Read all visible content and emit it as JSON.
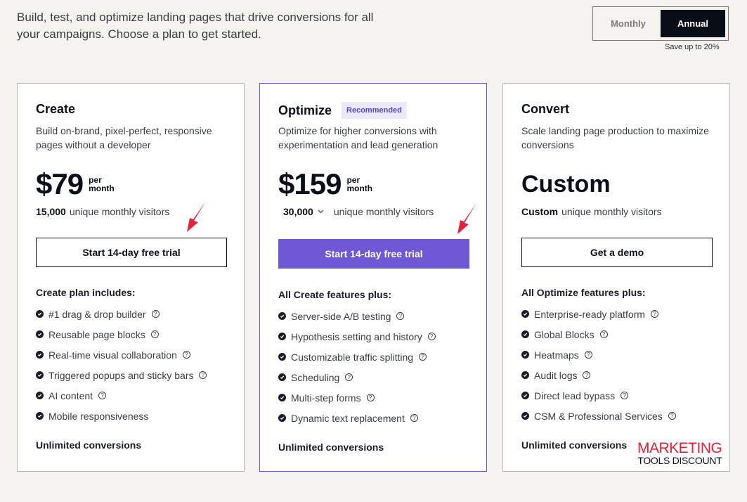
{
  "intro": {
    "text": "Build, test, and optimize landing pages that drive conversions for all your campaigns. Choose a plan to get started."
  },
  "billing": {
    "options": [
      "Monthly",
      "Annual"
    ],
    "selected": "Annual",
    "save_note": "Save up to 20%"
  },
  "colors": {
    "accent": "#6e58d4",
    "dark": "#0b0f1a",
    "background": "#f4f3ef",
    "annotation_arrow": "#e4213a"
  },
  "plans": [
    {
      "name": "Create",
      "badge": null,
      "description": "Build on-brand, pixel-perfect, responsive pages without a developer",
      "price": "$79",
      "price_unit_1": "per",
      "price_unit_2": "month",
      "visitors_value": "15,000",
      "visitors_label": "unique monthly visitors",
      "visitors_selectable": false,
      "cta": "Start 14-day free trial",
      "features_title": "Create plan includes:",
      "features": [
        {
          "label": "#1 drag & drop builder",
          "help": true
        },
        {
          "label": "Reusable page blocks",
          "help": true
        },
        {
          "label": "Real-time visual collaboration",
          "help": true
        },
        {
          "label": "Triggered popups and sticky bars",
          "help": true
        },
        {
          "label": "AI content",
          "help": true
        },
        {
          "label": "Mobile responsiveness",
          "help": false
        }
      ],
      "footer": "Unlimited conversions"
    },
    {
      "name": "Optimize",
      "badge": "Recommended",
      "description": "Optimize for higher conversions with experimentation and lead generation",
      "price": "$159",
      "price_unit_1": "per",
      "price_unit_2": "month",
      "visitors_value": "30,000",
      "visitors_label": "unique monthly visitors",
      "visitors_selectable": true,
      "cta": "Start 14-day free trial",
      "features_title": "All Create features plus:",
      "features": [
        {
          "label": "Server-side A/B testing",
          "help": true
        },
        {
          "label": "Hypothesis setting and history",
          "help": true
        },
        {
          "label": "Customizable traffic splitting",
          "help": true
        },
        {
          "label": "Scheduling",
          "help": true
        },
        {
          "label": "Multi-step forms",
          "help": true
        },
        {
          "label": "Dynamic text replacement",
          "help": true
        }
      ],
      "footer": "Unlimited conversions"
    },
    {
      "name": "Convert",
      "badge": null,
      "description": "Scale landing page production to maximize conversions",
      "price": "Custom",
      "visitors_value": "Custom",
      "visitors_label": "unique monthly visitors",
      "visitors_selectable": false,
      "cta": "Get a demo",
      "features_title": "All Optimize features plus:",
      "features": [
        {
          "label": "Enterprise-ready platform",
          "help": true
        },
        {
          "label": "Global Blocks",
          "help": true
        },
        {
          "label": "Heatmaps",
          "help": true
        },
        {
          "label": "Audit logs",
          "help": true
        },
        {
          "label": "Direct lead bypass",
          "help": true
        },
        {
          "label": "CSM & Professional Services",
          "help": true
        }
      ],
      "footer": "Unlimited conversions"
    }
  ],
  "icons": {
    "check": "check-circle-icon",
    "help": "help-circle-icon",
    "help_glyph": "?",
    "chevron": "chevron-down-icon",
    "chevron_glyph": "⌄"
  },
  "watermark": {
    "line1": "MARKETING",
    "line2": "TOOLS DISCOUNT"
  }
}
